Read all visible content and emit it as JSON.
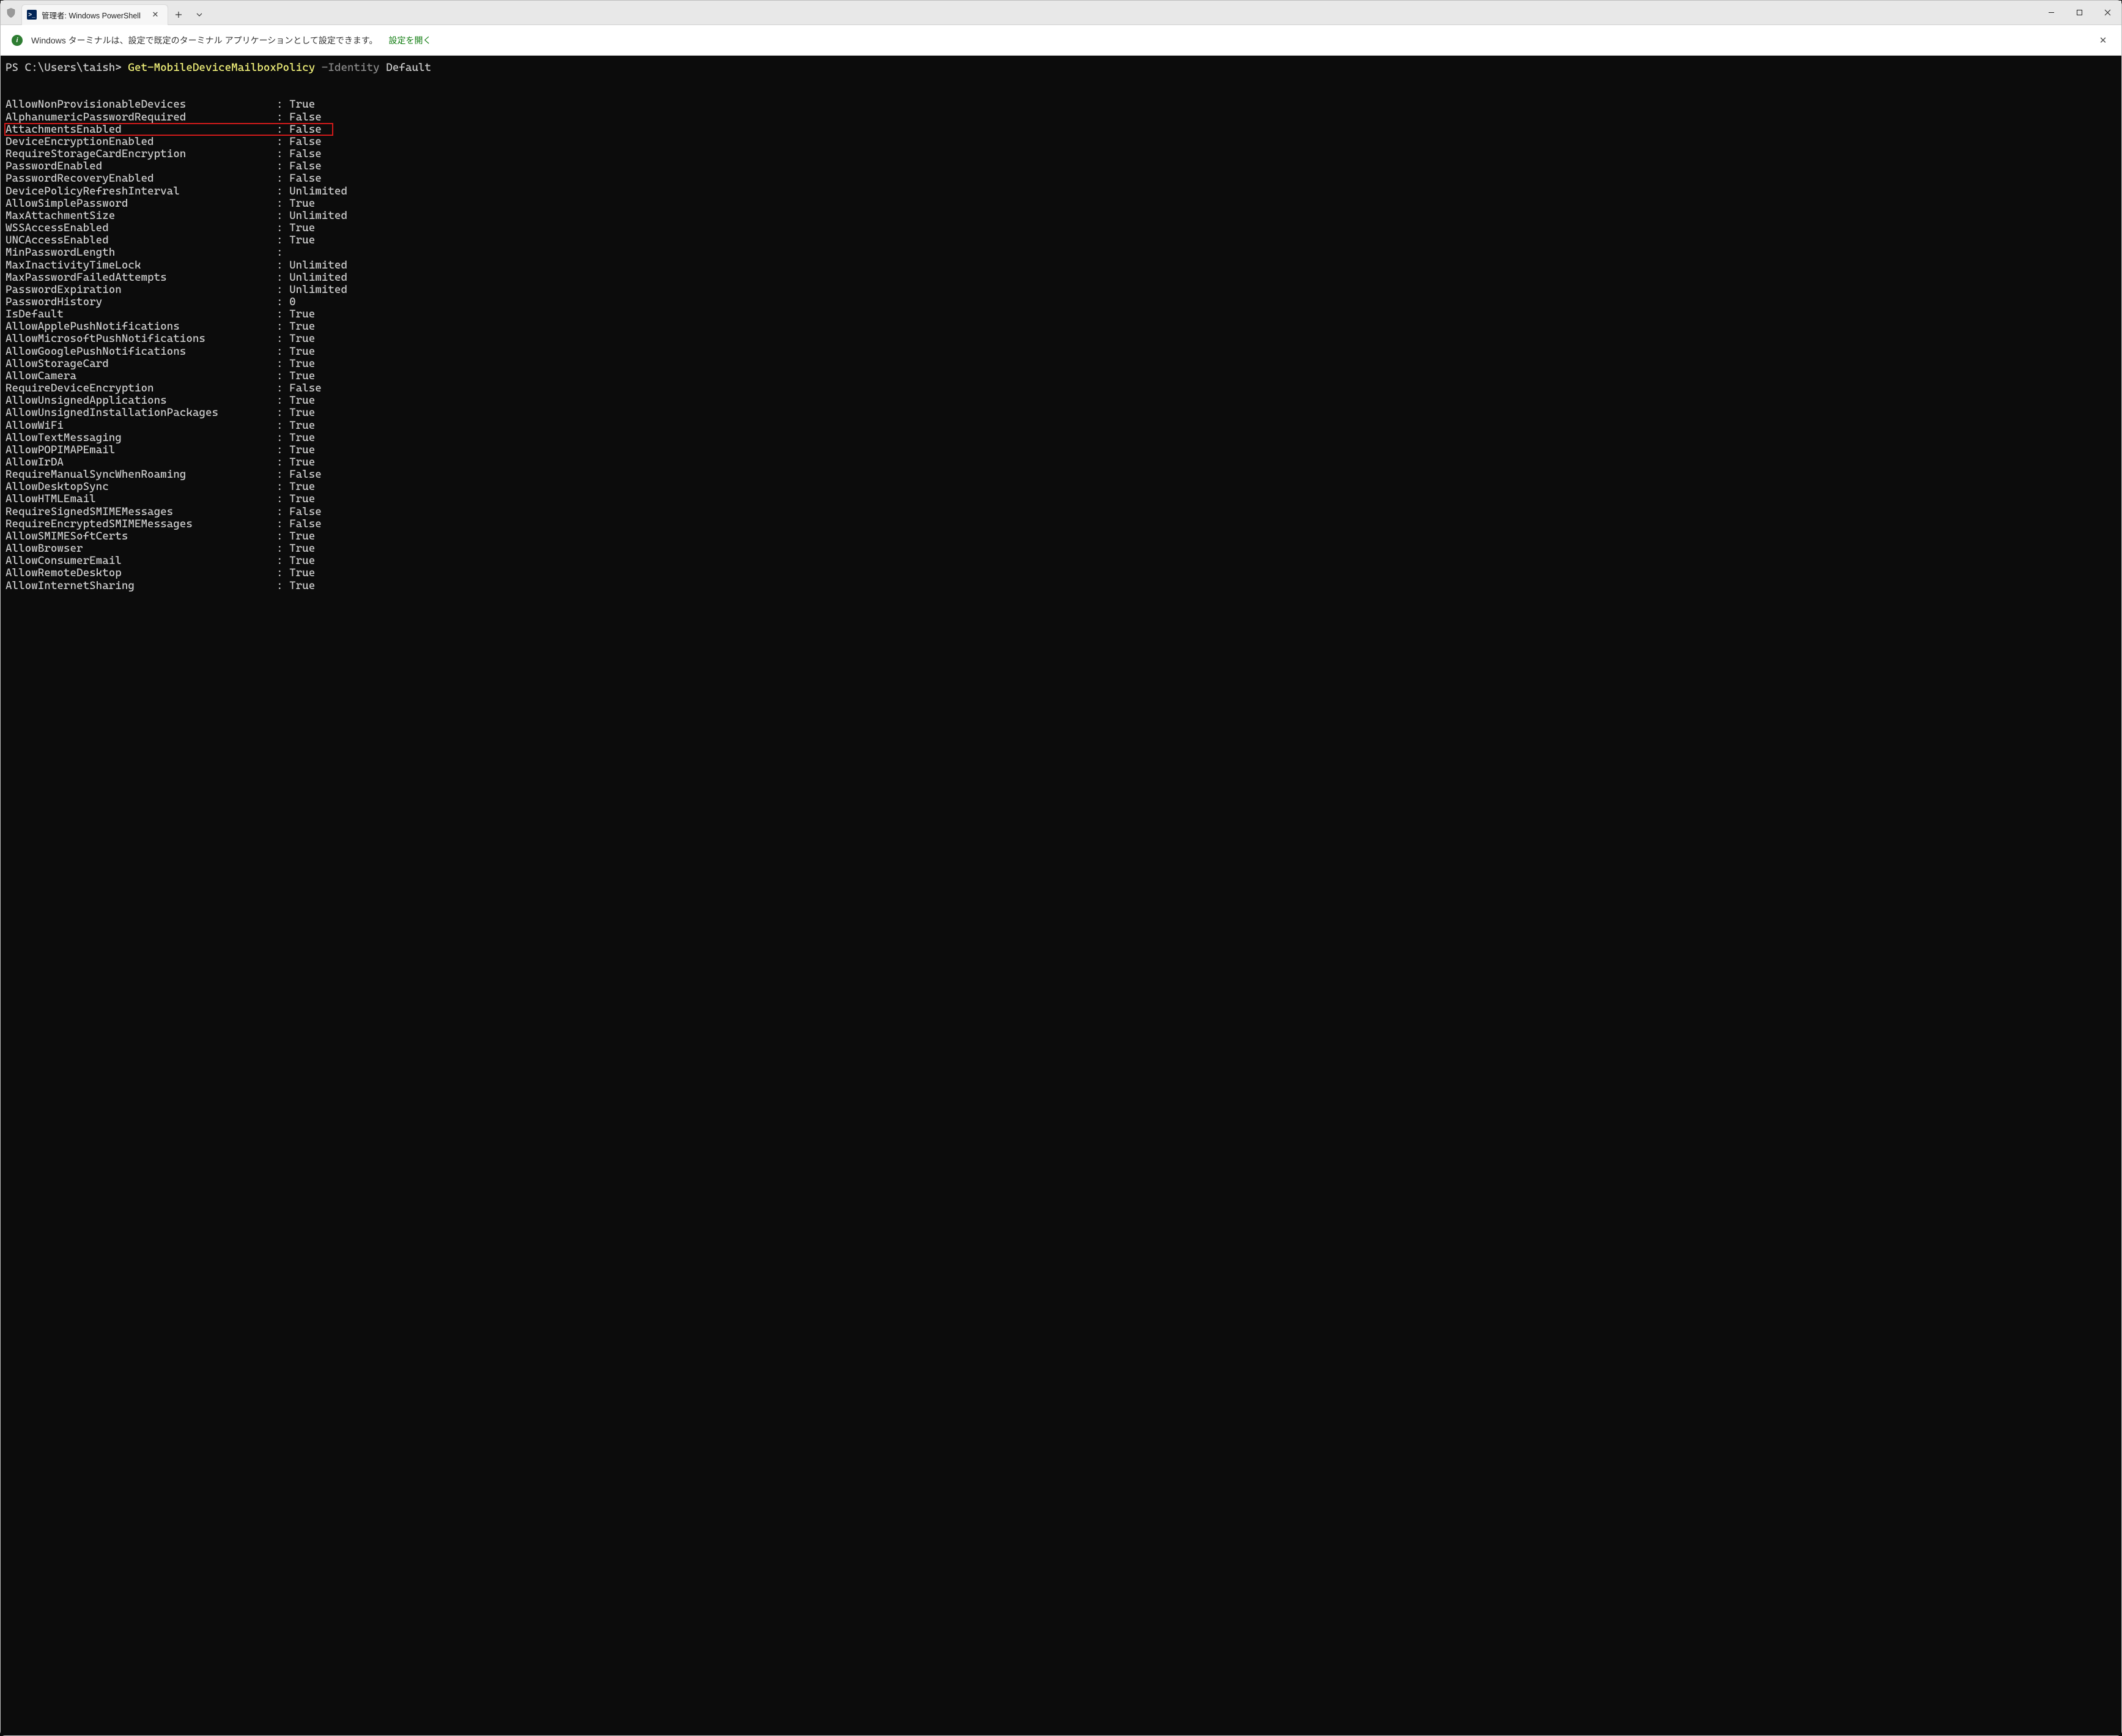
{
  "tab": {
    "title": "管理者: Windows PowerShell"
  },
  "infobar": {
    "text": "Windows ターミナルは、設定で既定のターミナル アプリケーションとして設定できます。",
    "link": "設定を開く"
  },
  "prompt": {
    "ps": "PS C:\\Users\\taish> ",
    "cmd": "Get-MobileDeviceMailboxPolicy",
    "param": " -Identity",
    "arg": " Default"
  },
  "rows": [
    {
      "k": "AllowNonProvisionableDevices",
      "v": "True"
    },
    {
      "k": "AlphanumericPasswordRequired",
      "v": "False"
    },
    {
      "k": "AttachmentsEnabled",
      "v": "False",
      "hl": true
    },
    {
      "k": "DeviceEncryptionEnabled",
      "v": "False"
    },
    {
      "k": "RequireStorageCardEncryption",
      "v": "False"
    },
    {
      "k": "PasswordEnabled",
      "v": "False"
    },
    {
      "k": "PasswordRecoveryEnabled",
      "v": "False"
    },
    {
      "k": "DevicePolicyRefreshInterval",
      "v": "Unlimited"
    },
    {
      "k": "AllowSimplePassword",
      "v": "True"
    },
    {
      "k": "MaxAttachmentSize",
      "v": "Unlimited"
    },
    {
      "k": "WSSAccessEnabled",
      "v": "True"
    },
    {
      "k": "UNCAccessEnabled",
      "v": "True"
    },
    {
      "k": "MinPasswordLength",
      "v": ""
    },
    {
      "k": "MaxInactivityTimeLock",
      "v": "Unlimited"
    },
    {
      "k": "MaxPasswordFailedAttempts",
      "v": "Unlimited"
    },
    {
      "k": "PasswordExpiration",
      "v": "Unlimited"
    },
    {
      "k": "PasswordHistory",
      "v": "0"
    },
    {
      "k": "IsDefault",
      "v": "True"
    },
    {
      "k": "AllowApplePushNotifications",
      "v": "True"
    },
    {
      "k": "AllowMicrosoftPushNotifications",
      "v": "True"
    },
    {
      "k": "AllowGooglePushNotifications",
      "v": "True"
    },
    {
      "k": "AllowStorageCard",
      "v": "True"
    },
    {
      "k": "AllowCamera",
      "v": "True"
    },
    {
      "k": "RequireDeviceEncryption",
      "v": "False"
    },
    {
      "k": "AllowUnsignedApplications",
      "v": "True"
    },
    {
      "k": "AllowUnsignedInstallationPackages",
      "v": "True"
    },
    {
      "k": "AllowWiFi",
      "v": "True"
    },
    {
      "k": "AllowTextMessaging",
      "v": "True"
    },
    {
      "k": "AllowPOPIMAPEmail",
      "v": "True"
    },
    {
      "k": "AllowIrDA",
      "v": "True"
    },
    {
      "k": "RequireManualSyncWhenRoaming",
      "v": "False"
    },
    {
      "k": "AllowDesktopSync",
      "v": "True"
    },
    {
      "k": "AllowHTMLEmail",
      "v": "True"
    },
    {
      "k": "RequireSignedSMIMEMessages",
      "v": "False"
    },
    {
      "k": "RequireEncryptedSMIMEMessages",
      "v": "False"
    },
    {
      "k": "AllowSMIMESoftCerts",
      "v": "True"
    },
    {
      "k": "AllowBrowser",
      "v": "True"
    },
    {
      "k": "AllowConsumerEmail",
      "v": "True"
    },
    {
      "k": "AllowRemoteDesktop",
      "v": "True"
    },
    {
      "k": "AllowInternetSharing",
      "v": "True"
    }
  ]
}
